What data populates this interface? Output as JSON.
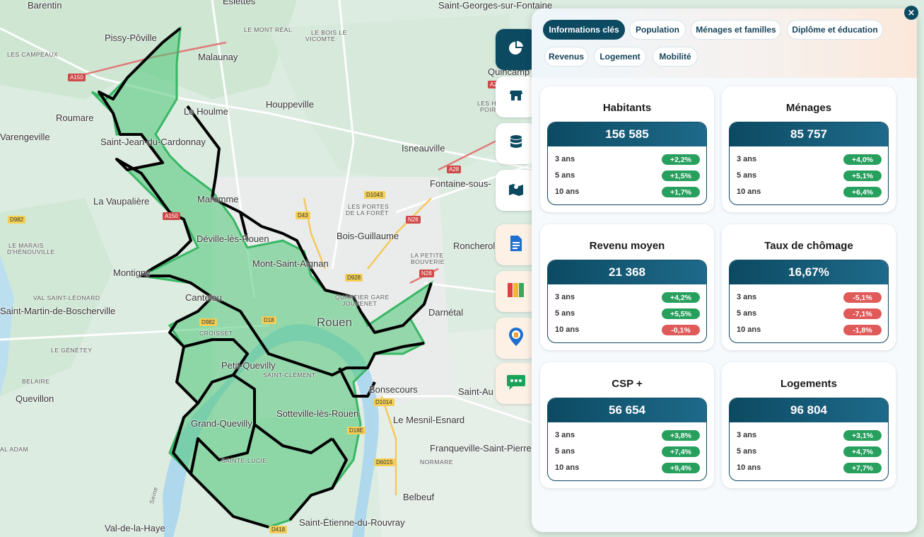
{
  "map": {
    "labels": [
      {
        "text": "Barentin",
        "cls": ""
      },
      {
        "text": "Pissy-Pôville",
        "cls": ""
      },
      {
        "text": "Malaunay",
        "cls": ""
      },
      {
        "text": "LE MONT RÉAL",
        "cls": "small"
      },
      {
        "text": "LE BOIS LE",
        "cls": "small"
      },
      {
        "text": "VICOMTE",
        "cls": "small"
      },
      {
        "text": "LES CAMPEAUX",
        "cls": "small"
      },
      {
        "text": "Saint-Georges-sur-Fontaine",
        "cls": ""
      },
      {
        "text": "Esiettes",
        "cls": ""
      },
      {
        "text": "Quincamp",
        "cls": ""
      },
      {
        "text": "Roumare",
        "cls": ""
      },
      {
        "text": "Le Houlme",
        "cls": ""
      },
      {
        "text": "Houppeville",
        "cls": ""
      },
      {
        "text": "LES HAUTS",
        "cls": "small"
      },
      {
        "text": "POIRIERS",
        "cls": "small"
      },
      {
        "text": "Varengeville",
        "cls": ""
      },
      {
        "text": "Saint-Jean-du-Cardonnay",
        "cls": ""
      },
      {
        "text": "Isneauville",
        "cls": ""
      },
      {
        "text": "Fontaine-sous-",
        "cls": ""
      },
      {
        "text": "La Vaupalière",
        "cls": ""
      },
      {
        "text": "Maromme",
        "cls": ""
      },
      {
        "text": "LES PORTES",
        "cls": "small"
      },
      {
        "text": "DE LA FORÊT",
        "cls": "small"
      },
      {
        "text": "Bois-Guillaume",
        "cls": ""
      },
      {
        "text": "Déville-lès-Rouen",
        "cls": ""
      },
      {
        "text": "LE MARAIS",
        "cls": "small"
      },
      {
        "text": "D'HÉNOUVILLE",
        "cls": "small"
      },
      {
        "text": "Roncherolles",
        "cls": ""
      },
      {
        "text": "LA PETITE",
        "cls": "small"
      },
      {
        "text": "BOUVERIE",
        "cls": "small"
      },
      {
        "text": "Mont-Saint-Aignan",
        "cls": ""
      },
      {
        "text": "Montigny",
        "cls": ""
      },
      {
        "text": "VAL SAINT-LÉONARD",
        "cls": "small"
      },
      {
        "text": "Canteleu",
        "cls": ""
      },
      {
        "text": "QUARTIER GARE",
        "cls": "small"
      },
      {
        "text": "JOUVENET",
        "cls": "small"
      },
      {
        "text": "Saint-Martin-de-Boscherville",
        "cls": ""
      },
      {
        "text": "Darnétal",
        "cls": ""
      },
      {
        "text": "Rouen",
        "cls": "city"
      },
      {
        "text": "CROISSET",
        "cls": "small"
      },
      {
        "text": "LE GÉNÉTEY",
        "cls": "small"
      },
      {
        "text": "Petit-Quevilly",
        "cls": ""
      },
      {
        "text": "SAINT-CLÉMENT",
        "cls": "small"
      },
      {
        "text": "BELAIRE",
        "cls": "small"
      },
      {
        "text": "Bonsecours",
        "cls": ""
      },
      {
        "text": "Saint-Au",
        "cls": ""
      },
      {
        "text": "Quevillon",
        "cls": ""
      },
      {
        "text": "Sotteville-lès-Rouen",
        "cls": ""
      },
      {
        "text": "Le Mesnil-Esnard",
        "cls": ""
      },
      {
        "text": "Grand-Quevilly",
        "cls": ""
      },
      {
        "text": "Franqueville-Saint-Pierre",
        "cls": ""
      },
      {
        "text": "AL ADAM",
        "cls": "small"
      },
      {
        "text": "SAINTE-LUCIE",
        "cls": "small"
      },
      {
        "text": "NORMARE",
        "cls": "small"
      },
      {
        "text": "Belbeuf",
        "cls": ""
      },
      {
        "text": "Val-de-la-Haye",
        "cls": ""
      },
      {
        "text": "Saint-Étienne-du-Rouvray",
        "cls": ""
      },
      {
        "text": "Seine",
        "cls": "small"
      }
    ],
    "roads": [
      {
        "text": "A150",
        "cls": "red"
      },
      {
        "text": "A150",
        "cls": "red"
      },
      {
        "text": "A28",
        "cls": "red"
      },
      {
        "text": "D1043",
        "cls": "yellow"
      },
      {
        "text": "D43",
        "cls": "yellow"
      },
      {
        "text": "N28",
        "cls": "red"
      },
      {
        "text": "D982",
        "cls": "yellow"
      },
      {
        "text": "D928",
        "cls": "yellow"
      },
      {
        "text": "N28",
        "cls": "red"
      },
      {
        "text": "D982",
        "cls": "yellow"
      },
      {
        "text": "D18",
        "cls": "yellow"
      },
      {
        "text": "D18E",
        "cls": "yellow"
      },
      {
        "text": "D6015",
        "cls": "yellow"
      },
      {
        "text": "D418",
        "cls": "yellow"
      },
      {
        "text": "D1014",
        "cls": "yellow"
      },
      {
        "text": "A28",
        "cls": "red"
      }
    ]
  },
  "rail": {
    "buttons": [
      {
        "name": "pie-chart-icon",
        "state": "active"
      },
      {
        "name": "shop-icon",
        "state": ""
      },
      {
        "name": "database-icon",
        "state": ""
      },
      {
        "name": "map-icon",
        "state": ""
      },
      {
        "name": "document-icon",
        "state": "tinted"
      },
      {
        "name": "flag-stripes-icon",
        "state": "tinted"
      },
      {
        "name": "location-pin-icon",
        "state": "tinted"
      },
      {
        "name": "chat-bubble-icon",
        "state": "tinted"
      }
    ]
  },
  "panel": {
    "close_label": "×",
    "tabs": [
      {
        "label": "Informations clés",
        "active": true
      },
      {
        "label": "Population",
        "active": false
      },
      {
        "label": "Ménages et familles",
        "active": false
      },
      {
        "label": "Diplôme et éducation",
        "active": false
      },
      {
        "label": "Revenus",
        "active": false
      },
      {
        "label": "Logement",
        "active": false
      },
      {
        "label": "Mobilité",
        "active": false
      }
    ],
    "cards": [
      {
        "title": "Habitants",
        "value": "156 585",
        "rows": [
          {
            "label": "3 ans",
            "change": "+2,2%",
            "trend": "pos"
          },
          {
            "label": "5 ans",
            "change": "+1,5%",
            "trend": "pos"
          },
          {
            "label": "10 ans",
            "change": "+1,7%",
            "trend": "pos"
          }
        ]
      },
      {
        "title": "Ménages",
        "value": "85 757",
        "rows": [
          {
            "label": "3 ans",
            "change": "+4,0%",
            "trend": "pos"
          },
          {
            "label": "5 ans",
            "change": "+5,1%",
            "trend": "pos"
          },
          {
            "label": "10 ans",
            "change": "+6,4%",
            "trend": "pos"
          }
        ]
      },
      {
        "title": "Revenu moyen",
        "value": "21 368",
        "rows": [
          {
            "label": "3 ans",
            "change": "+4,2%",
            "trend": "pos"
          },
          {
            "label": "5 ans",
            "change": "+5,5%",
            "trend": "pos"
          },
          {
            "label": "10 ans",
            "change": "-0,1%",
            "trend": "neg"
          }
        ]
      },
      {
        "title": "Taux de chômage",
        "value": "16,67%",
        "rows": [
          {
            "label": "3 ans",
            "change": "-5,1%",
            "trend": "neg"
          },
          {
            "label": "5 ans",
            "change": "-7,1%",
            "trend": "neg"
          },
          {
            "label": "10 ans",
            "change": "-1,8%",
            "trend": "neg"
          }
        ]
      },
      {
        "title": "CSP +",
        "value": "56 654",
        "rows": [
          {
            "label": "3 ans",
            "change": "+3,8%",
            "trend": "pos"
          },
          {
            "label": "5 ans",
            "change": "+7,4%",
            "trend": "pos"
          },
          {
            "label": "10 ans",
            "change": "+9,4%",
            "trend": "pos"
          }
        ]
      },
      {
        "title": "Logements",
        "value": "96 804",
        "rows": [
          {
            "label": "3 ans",
            "change": "+3,1%",
            "trend": "pos"
          },
          {
            "label": "5 ans",
            "change": "+4,7%",
            "trend": "pos"
          },
          {
            "label": "10 ans",
            "change": "+7,7%",
            "trend": "pos"
          }
        ]
      }
    ]
  },
  "colors": {
    "accent": "#0c4a62",
    "positive": "#27a05e",
    "negative": "#e05a5a",
    "zone_fill": "#4cc776",
    "zone_border": "#000000"
  }
}
